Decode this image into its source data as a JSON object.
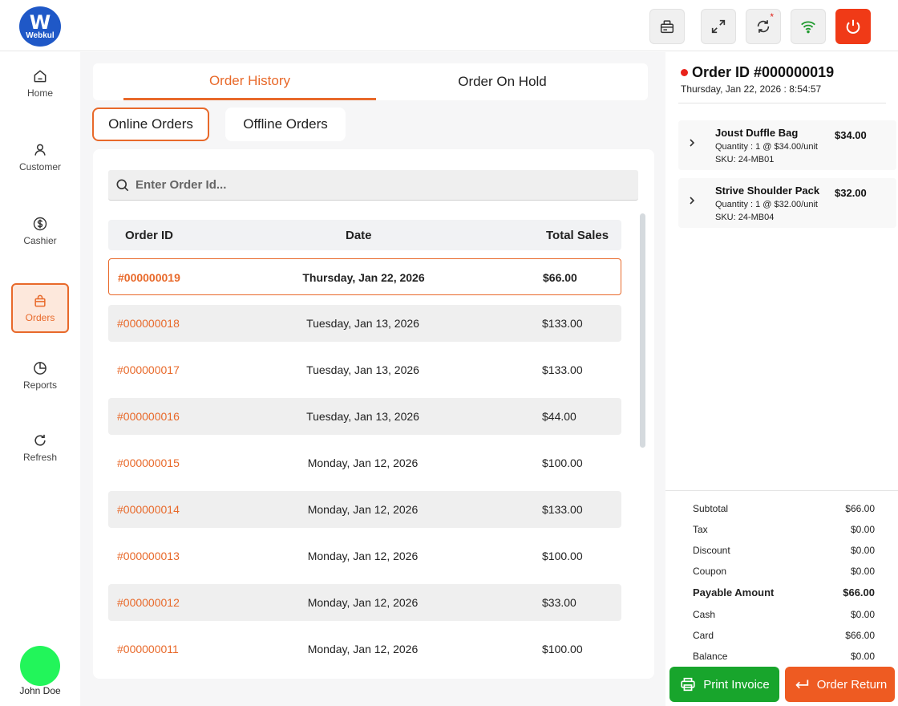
{
  "header": {
    "logo_text": "Webkul",
    "icons": [
      "card-reader-icon",
      "fullscreen-icon",
      "sync-icon",
      "wifi-icon",
      "power-icon"
    ]
  },
  "sidebar": {
    "items": [
      {
        "label": "Home",
        "icon": "home-icon"
      },
      {
        "label": "Customer",
        "icon": "user-icon"
      },
      {
        "label": "Cashier",
        "icon": "dollar-icon"
      },
      {
        "label": "Orders",
        "icon": "bag-icon",
        "active": true
      },
      {
        "label": "Reports",
        "icon": "pie-chart-icon"
      },
      {
        "label": "Refresh",
        "icon": "refresh-icon"
      }
    ],
    "user_name": "John Doe"
  },
  "tabs": {
    "history": "Order History",
    "hold": "Order On Hold"
  },
  "subtabs": {
    "online": "Online Orders",
    "offline": "Offline Orders"
  },
  "search": {
    "placeholder": "Enter Order Id..."
  },
  "table": {
    "headers": {
      "order_id": "Order ID",
      "date": "Date",
      "total": "Total Sales"
    },
    "rows": [
      {
        "id": "#000000019",
        "date": "Thursday, Jan 22, 2026",
        "total": "$66.00"
      },
      {
        "id": "#000000018",
        "date": "Tuesday, Jan 13, 2026",
        "total": "$133.00"
      },
      {
        "id": "#000000017",
        "date": "Tuesday, Jan 13, 2026",
        "total": "$133.00"
      },
      {
        "id": "#000000016",
        "date": "Tuesday, Jan 13, 2026",
        "total": "$44.00"
      },
      {
        "id": "#000000015",
        "date": "Monday, Jan 12, 2026",
        "total": "$100.00"
      },
      {
        "id": "#000000014",
        "date": "Monday, Jan 12, 2026",
        "total": "$133.00"
      },
      {
        "id": "#000000013",
        "date": "Monday, Jan 12, 2026",
        "total": "$100.00"
      },
      {
        "id": "#000000012",
        "date": "Monday, Jan 12, 2026",
        "total": "$33.00"
      },
      {
        "id": "#000000011",
        "date": "Monday, Jan 12, 2026",
        "total": "$100.00"
      }
    ]
  },
  "order": {
    "title": "Order ID #000000019",
    "datetime": "Thursday, Jan 22, 2026 : 8:54:57",
    "items": [
      {
        "name": "Joust Duffle Bag",
        "quantity": "Quantity : 1 @ $34.00/unit",
        "sku": "SKU: 24-MB01",
        "price": "$34.00"
      },
      {
        "name": "Strive Shoulder Pack",
        "quantity": "Quantity : 1 @ $32.00/unit",
        "sku": "SKU: 24-MB04",
        "price": "$32.00"
      }
    ],
    "summary": {
      "subtotal_label": "Subtotal",
      "subtotal": "$66.00",
      "tax_label": "Tax",
      "tax": "$0.00",
      "discount_label": "Discount",
      "discount": "$0.00",
      "coupon_label": "Coupon",
      "coupon": "$0.00",
      "payable_label": "Payable Amount",
      "payable": "$66.00",
      "cash_label": "Cash",
      "cash": "$0.00",
      "card_label": "Card",
      "card": "$66.00",
      "balance_label": "Balance",
      "balance": "$0.00"
    },
    "actions": {
      "print": "Print Invoice",
      "return": "Order Return"
    }
  },
  "colors": {
    "accent": "#e8692a",
    "power": "#f03a17",
    "print_button": "#18a52c",
    "return_button": "#ee5b22",
    "avatar": "#22f55a",
    "logo": "#1f58c7"
  }
}
